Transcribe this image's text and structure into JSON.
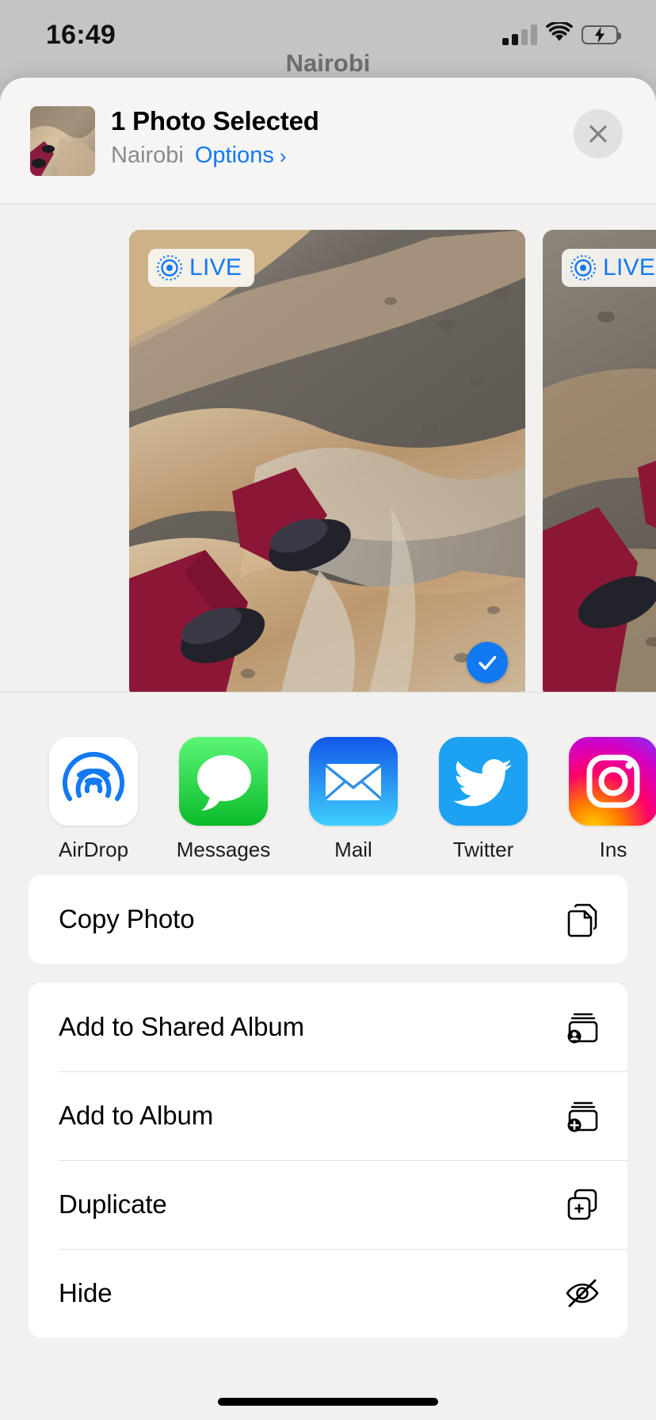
{
  "status_bar": {
    "time": "16:49",
    "signal_icon": "cellular-signal-icon",
    "signal_bars_filled": 2,
    "signal_bars_total": 4,
    "wifi_icon": "wifi-icon",
    "battery_icon": "battery-charging-icon",
    "battery_percent": 52,
    "battery_color": "#34c759",
    "charging": true
  },
  "backdrop": {
    "title": "Nairobi"
  },
  "sheet": {
    "header": {
      "thumbnail_name": "selected-photo-thumbnail",
      "title": "1 Photo Selected",
      "subtitle": "Nairobi",
      "options_label": "Options",
      "options_chevron": "›",
      "close_icon": "close-icon"
    },
    "carousel": {
      "photos": [
        {
          "badge": "LIVE",
          "badge_icon": "live-photo-icon",
          "selected": true,
          "alt": "Overhead photo of feet in black shoes and maroon trousers on rocky ground"
        },
        {
          "badge": "LIVE",
          "badge_icon": "live-photo-icon",
          "selected": false,
          "alt": "Overhead photo of feet on gravel ground"
        }
      ]
    },
    "apps": [
      {
        "label": "AirDrop",
        "icon": "airdrop-icon",
        "color": "#ffffff"
      },
      {
        "label": "Messages",
        "icon": "messages-icon",
        "color": "#30d158"
      },
      {
        "label": "Mail",
        "icon": "mail-icon",
        "color": "#1d7ef5"
      },
      {
        "label": "Twitter",
        "icon": "twitter-icon",
        "color": "#1da1f2"
      },
      {
        "label": "Ins",
        "icon": "instagram-icon",
        "color": "#d62976"
      }
    ],
    "action_groups": [
      {
        "rows": [
          {
            "label": "Copy Photo",
            "icon": "copy-photo-icon"
          }
        ]
      },
      {
        "rows": [
          {
            "label": "Add to Shared Album",
            "icon": "add-to-shared-album-icon"
          },
          {
            "label": "Add to Album",
            "icon": "add-to-album-icon"
          },
          {
            "label": "Duplicate",
            "icon": "duplicate-icon"
          },
          {
            "label": "Hide",
            "icon": "hide-icon"
          }
        ]
      }
    ]
  },
  "accent_color": "#1279f2",
  "home_indicator": "home-indicator"
}
